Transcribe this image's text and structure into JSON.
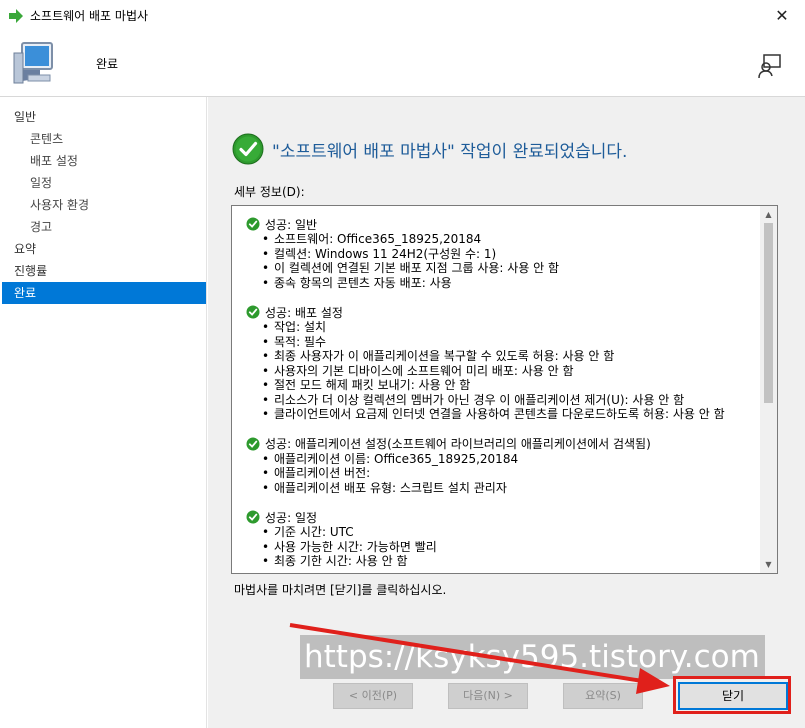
{
  "window": {
    "title": "소프트웨어 배포 마법사",
    "close_glyph": "✕"
  },
  "header": {
    "page_title": "완료"
  },
  "nav": {
    "items": [
      {
        "label": "일반",
        "level": 0,
        "active": false
      },
      {
        "label": "콘텐츠",
        "level": 1,
        "active": false
      },
      {
        "label": "배포 설정",
        "level": 1,
        "active": false
      },
      {
        "label": "일정",
        "level": 1,
        "active": false
      },
      {
        "label": "사용자 환경",
        "level": 1,
        "active": false
      },
      {
        "label": "경고",
        "level": 1,
        "active": false
      },
      {
        "label": "요약",
        "level": 0,
        "active": false
      },
      {
        "label": "진행률",
        "level": 0,
        "active": false
      },
      {
        "label": "완료",
        "level": 0,
        "active": true
      }
    ]
  },
  "main": {
    "done_message": "\"소프트웨어 배포 마법사\" 작업이 완료되었습니다.",
    "details_label": "세부 정보(D):",
    "sections": [
      {
        "heading": "성공: 일반",
        "items": [
          "소프트웨어: Office365_18925,20184",
          "컬렉션: Windows 11 24H2(구성원 수: 1)",
          "이 컬렉션에 연결된 기본 배포 지점 그룹 사용: 사용 안 함",
          "종속 항목의 콘텐츠 자동 배포: 사용"
        ]
      },
      {
        "heading": "성공: 배포 설정",
        "items": [
          "작업: 설치",
          "목적: 필수",
          "최종 사용자가 이 애플리케이션을 복구할 수 있도록 허용: 사용 안 함",
          "사용자의 기본 디바이스에 소프트웨어 미리 배포: 사용 안 함",
          "절전 모드 해제 패킷 보내기: 사용 안 함",
          "리소스가 더 이상 컬렉션의 멤버가 아닌 경우 이 애플리케이션 제거(U): 사용 안 함",
          "클라이언트에서 요금제 인터넷 연결을 사용하여 콘텐츠를 다운로드하도록 허용: 사용 안 함"
        ]
      },
      {
        "heading": "성공: 애플리케이션 설정(소프트웨어 라이브러리의 애플리케이션에서 검색됨)",
        "items": [
          "애플리케이션 이름: Office365_18925,20184",
          "애플리케이션 버전:",
          "애플리케이션 배포 유형: 스크립트 설치 관리자"
        ]
      },
      {
        "heading": "성공: 일정",
        "items": [
          "기준 시간: UTC",
          "사용 가능한 시간: 가능하면 빨리",
          "최종 기한 시간: 사용 안 함"
        ]
      }
    ],
    "hint": "마법사를 마치려면 [닫기]를 클릭하십시오."
  },
  "buttons": {
    "prev": "< 이전(P)",
    "next": "다음(N) >",
    "summary": "요약(S)",
    "close": "닫기"
  },
  "watermark": "https://ksyksy595.tistory.com",
  "colors": {
    "accent": "#0078d7",
    "title_blue": "#1e5c99",
    "success_green": "#2e9a2e",
    "annotation_red": "#e0201b"
  }
}
